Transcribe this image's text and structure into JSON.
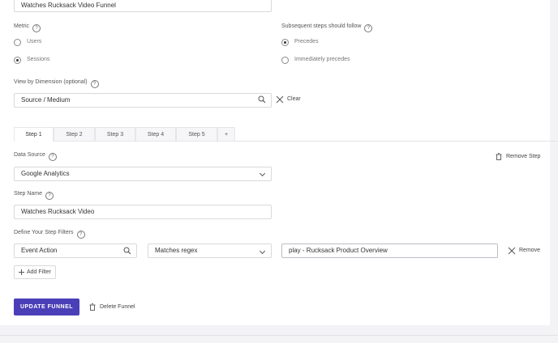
{
  "funnel_name": {
    "value": "Watches Rucksack Video Funnel"
  },
  "metric": {
    "label": "Metric",
    "options": [
      {
        "label": "Users",
        "selected": false
      },
      {
        "label": "Sessions",
        "selected": true
      }
    ]
  },
  "subsequent": {
    "label": "Subsequent steps should follow",
    "options": [
      {
        "label": "Precedes",
        "selected": true
      },
      {
        "label": "Immediately precedes",
        "selected": false
      }
    ]
  },
  "dimension": {
    "label": "View by Dimension (optional)",
    "value": "Source / Medium",
    "clear_label": "Clear"
  },
  "tabs": [
    {
      "label": "Step 1",
      "active": true
    },
    {
      "label": "Step 2",
      "active": false
    },
    {
      "label": "Step 3",
      "active": false
    },
    {
      "label": "Step 4",
      "active": false
    },
    {
      "label": "Step 5",
      "active": false
    },
    {
      "label": "+",
      "active": false
    }
  ],
  "data_source": {
    "label": "Data Source",
    "value": "Google Analytics",
    "remove_step_label": "Remove Step"
  },
  "step_name": {
    "label": "Step Name",
    "value": "Watches Rucksack Video"
  },
  "filters": {
    "label": "Define Your Step Filters",
    "field": "Event Action",
    "operator": "Matches regex",
    "value": "play - Rucksack Product Overview",
    "remove_label": "Remove",
    "add_label": "Add Filter"
  },
  "actions": {
    "update_label": "UPDATE FUNNEL",
    "delete_label": "Delete Funnel"
  },
  "colors": {
    "primary": "#4b3fb8",
    "border": "#d9d9de"
  }
}
